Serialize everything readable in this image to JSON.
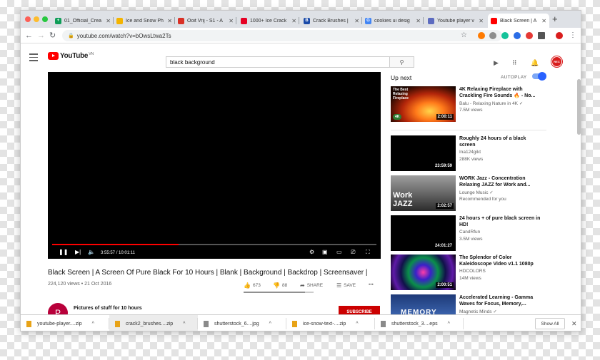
{
  "browser": {
    "tabs": [
      {
        "title": "01_Official_Crea",
        "icon": "sheets-icon",
        "color": "#0f9d58",
        "glyph": "+"
      },
      {
        "title": "Ice and Snow Ph",
        "icon": "image-icon",
        "color": "#f4b400",
        "glyph": ""
      },
      {
        "title": "Ooit Vrij - S1 - A",
        "icon": "lion-icon",
        "color": "#d93025",
        "glyph": ""
      },
      {
        "title": "1000+ Ice Crack",
        "icon": "pinterest-icon",
        "color": "#e60023",
        "glyph": ""
      },
      {
        "title": "Crack Brushes | ",
        "icon": "brush-site-icon",
        "color": "#1a4aa8",
        "glyph": "B"
      },
      {
        "title": "cookies ui desig",
        "icon": "google-icon",
        "color": "#4285f4",
        "glyph": "G"
      },
      {
        "title": "Youtube player v",
        "icon": "generic-site-icon",
        "color": "#5c6bc0",
        "glyph": ""
      },
      {
        "title": "Black Screen | A",
        "icon": "youtube-icon",
        "color": "#ff0000",
        "glyph": ""
      }
    ],
    "new_tab": "+",
    "url": "youtube.com/watch?v=bOwsLtwa2Ts"
  },
  "yt": {
    "logo_text": "YouTube",
    "region": "VN",
    "search_query": "black background",
    "user_badge": "REC"
  },
  "player": {
    "progress_fraction": 0.39,
    "time_current": "3:55:57",
    "time_separator": " / ",
    "time_total": "10:01:11"
  },
  "video": {
    "title": "Black Screen | A Screen Of Pure Black For 10 Hours | Blank | Background | Backdrop | Screensaver |",
    "views": "224,120 views",
    "date_separator": " • ",
    "date": "21 Oct 2016",
    "likes": "673",
    "dislikes": "88",
    "like_fraction": 0.88,
    "share_label": "SHARE",
    "save_label": "SAVE",
    "more_label": "•••",
    "channel_initial": "P",
    "channel_name": "Pictures of stuff for 10 hours",
    "subscribe_label": "SUBSCRIBE"
  },
  "sidebar": {
    "up_next_label": "Up next",
    "autoplay_label": "AUTOPLAY",
    "autoplay_on": true,
    "items": [
      {
        "title": "4K Relaxing Fireplace with Crackling Fire Sounds 🔥 - No...",
        "channel": "Balu - Relaxing Nature in 4K ✓",
        "views": "7.5M views",
        "duration": "2:00:11",
        "thumb": "fireplace",
        "thumb_text": "The Best Relaxing Fireplace",
        "thumb_badge": "4K"
      },
      {
        "title": "Roughly 24 hours of a black screen",
        "channel": "Ina124gikt",
        "views": "288K views",
        "duration": "23:59:59",
        "thumb": "black",
        "thumb_text": "",
        "thumb_badge": ""
      },
      {
        "title": "WORK Jazz - Concentration Relaxing JAZZ for Work and...",
        "channel": "Lounge Music ✓",
        "views": "Recommended for you",
        "duration": "2:02:57",
        "thumb": "jazz",
        "thumb_text": "Work JAZZ",
        "thumb_badge": ""
      },
      {
        "title": "24 hours + of pure black screen in HD!",
        "channel": "CandRfun",
        "views": "3.5M views",
        "duration": "24:01:27",
        "thumb": "black",
        "thumb_text": "",
        "thumb_badge": ""
      },
      {
        "title": "The Splendor of Color Kaleidoscope Video v1.1 1080p",
        "channel": "HDCOLORS",
        "views": "14M views",
        "duration": "2:00:51",
        "thumb": "kaleido",
        "thumb_text": "",
        "thumb_badge": ""
      },
      {
        "title": "Accelerated Learning - Gamma Waves for Focus, Memory,...",
        "channel": "Magnetic Minds ✓",
        "views": "",
        "duration": "",
        "thumb": "memory",
        "thumb_text": "MEMORY",
        "thumb_badge": ""
      }
    ]
  },
  "downloads": {
    "items": [
      {
        "name": "youtube-player....zip",
        "icon": "zip-file-icon",
        "color": "#e8a317"
      },
      {
        "name": "crack2_brushes....zip",
        "icon": "zip-file-icon",
        "color": "#e8a317"
      },
      {
        "name": "shutterstock_6....jpg",
        "icon": "image-file-icon",
        "color": "#8a8a8a"
      },
      {
        "name": "ice-snow-text-....zip",
        "icon": "zip-file-icon",
        "color": "#e8a317"
      },
      {
        "name": "shutterstock_3....eps",
        "icon": "eps-file-icon",
        "color": "#8a8a8a"
      }
    ],
    "show_all_label": "Show All",
    "close": "✕"
  }
}
